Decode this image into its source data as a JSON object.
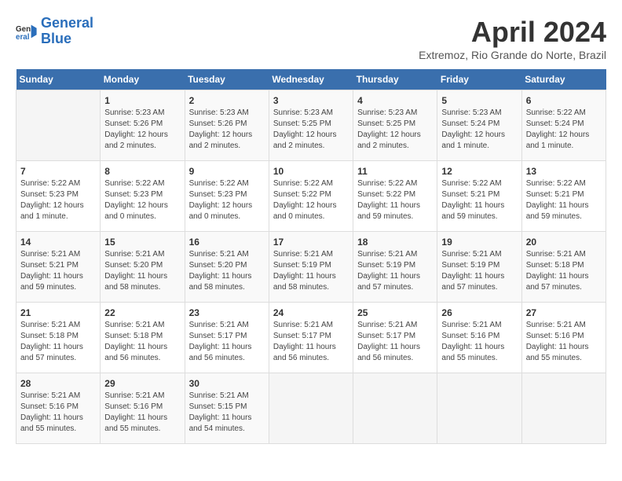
{
  "header": {
    "logo_line1": "General",
    "logo_line2": "Blue",
    "title": "April 2024",
    "subtitle": "Extremoz, Rio Grande do Norte, Brazil"
  },
  "days_of_week": [
    "Sunday",
    "Monday",
    "Tuesday",
    "Wednesday",
    "Thursday",
    "Friday",
    "Saturday"
  ],
  "weeks": [
    [
      {
        "day": "",
        "info": ""
      },
      {
        "day": "1",
        "info": "Sunrise: 5:23 AM\nSunset: 5:26 PM\nDaylight: 12 hours\nand 2 minutes."
      },
      {
        "day": "2",
        "info": "Sunrise: 5:23 AM\nSunset: 5:26 PM\nDaylight: 12 hours\nand 2 minutes."
      },
      {
        "day": "3",
        "info": "Sunrise: 5:23 AM\nSunset: 5:25 PM\nDaylight: 12 hours\nand 2 minutes."
      },
      {
        "day": "4",
        "info": "Sunrise: 5:23 AM\nSunset: 5:25 PM\nDaylight: 12 hours\nand 2 minutes."
      },
      {
        "day": "5",
        "info": "Sunrise: 5:23 AM\nSunset: 5:24 PM\nDaylight: 12 hours\nand 1 minute."
      },
      {
        "day": "6",
        "info": "Sunrise: 5:22 AM\nSunset: 5:24 PM\nDaylight: 12 hours\nand 1 minute."
      }
    ],
    [
      {
        "day": "7",
        "info": "Sunrise: 5:22 AM\nSunset: 5:23 PM\nDaylight: 12 hours\nand 1 minute."
      },
      {
        "day": "8",
        "info": "Sunrise: 5:22 AM\nSunset: 5:23 PM\nDaylight: 12 hours\nand 0 minutes."
      },
      {
        "day": "9",
        "info": "Sunrise: 5:22 AM\nSunset: 5:23 PM\nDaylight: 12 hours\nand 0 minutes."
      },
      {
        "day": "10",
        "info": "Sunrise: 5:22 AM\nSunset: 5:22 PM\nDaylight: 12 hours\nand 0 minutes."
      },
      {
        "day": "11",
        "info": "Sunrise: 5:22 AM\nSunset: 5:22 PM\nDaylight: 11 hours\nand 59 minutes."
      },
      {
        "day": "12",
        "info": "Sunrise: 5:22 AM\nSunset: 5:21 PM\nDaylight: 11 hours\nand 59 minutes."
      },
      {
        "day": "13",
        "info": "Sunrise: 5:22 AM\nSunset: 5:21 PM\nDaylight: 11 hours\nand 59 minutes."
      }
    ],
    [
      {
        "day": "14",
        "info": "Sunrise: 5:21 AM\nSunset: 5:21 PM\nDaylight: 11 hours\nand 59 minutes."
      },
      {
        "day": "15",
        "info": "Sunrise: 5:21 AM\nSunset: 5:20 PM\nDaylight: 11 hours\nand 58 minutes."
      },
      {
        "day": "16",
        "info": "Sunrise: 5:21 AM\nSunset: 5:20 PM\nDaylight: 11 hours\nand 58 minutes."
      },
      {
        "day": "17",
        "info": "Sunrise: 5:21 AM\nSunset: 5:19 PM\nDaylight: 11 hours\nand 58 minutes."
      },
      {
        "day": "18",
        "info": "Sunrise: 5:21 AM\nSunset: 5:19 PM\nDaylight: 11 hours\nand 57 minutes."
      },
      {
        "day": "19",
        "info": "Sunrise: 5:21 AM\nSunset: 5:19 PM\nDaylight: 11 hours\nand 57 minutes."
      },
      {
        "day": "20",
        "info": "Sunrise: 5:21 AM\nSunset: 5:18 PM\nDaylight: 11 hours\nand 57 minutes."
      }
    ],
    [
      {
        "day": "21",
        "info": "Sunrise: 5:21 AM\nSunset: 5:18 PM\nDaylight: 11 hours\nand 57 minutes."
      },
      {
        "day": "22",
        "info": "Sunrise: 5:21 AM\nSunset: 5:18 PM\nDaylight: 11 hours\nand 56 minutes."
      },
      {
        "day": "23",
        "info": "Sunrise: 5:21 AM\nSunset: 5:17 PM\nDaylight: 11 hours\nand 56 minutes."
      },
      {
        "day": "24",
        "info": "Sunrise: 5:21 AM\nSunset: 5:17 PM\nDaylight: 11 hours\nand 56 minutes."
      },
      {
        "day": "25",
        "info": "Sunrise: 5:21 AM\nSunset: 5:17 PM\nDaylight: 11 hours\nand 56 minutes."
      },
      {
        "day": "26",
        "info": "Sunrise: 5:21 AM\nSunset: 5:16 PM\nDaylight: 11 hours\nand 55 minutes."
      },
      {
        "day": "27",
        "info": "Sunrise: 5:21 AM\nSunset: 5:16 PM\nDaylight: 11 hours\nand 55 minutes."
      }
    ],
    [
      {
        "day": "28",
        "info": "Sunrise: 5:21 AM\nSunset: 5:16 PM\nDaylight: 11 hours\nand 55 minutes."
      },
      {
        "day": "29",
        "info": "Sunrise: 5:21 AM\nSunset: 5:16 PM\nDaylight: 11 hours\nand 55 minutes."
      },
      {
        "day": "30",
        "info": "Sunrise: 5:21 AM\nSunset: 5:15 PM\nDaylight: 11 hours\nand 54 minutes."
      },
      {
        "day": "",
        "info": ""
      },
      {
        "day": "",
        "info": ""
      },
      {
        "day": "",
        "info": ""
      },
      {
        "day": "",
        "info": ""
      }
    ]
  ]
}
